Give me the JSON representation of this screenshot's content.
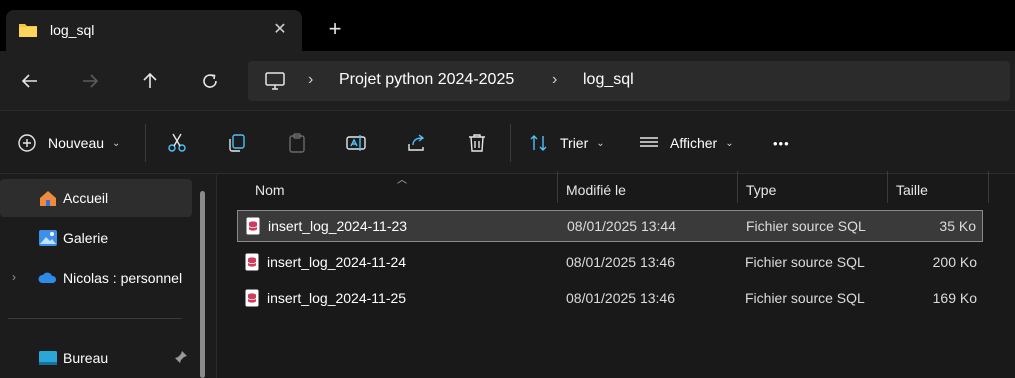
{
  "tab": {
    "title": "log_sql",
    "close_symbol": "✕",
    "new_tab_symbol": "+"
  },
  "nav": {
    "back_icon": "arrow-left-icon",
    "forward_icon": "arrow-right-icon",
    "up_icon": "arrow-up-icon",
    "refresh_icon": "refresh-icon",
    "breadcrumb": [
      "Projet python 2024-2025",
      "log_sql"
    ]
  },
  "toolbar": {
    "new_label": "Nouveau",
    "sort_label": "Trier",
    "view_label": "Afficher",
    "more_symbol": "•••"
  },
  "sidebar": {
    "items": [
      {
        "label": "Accueil",
        "icon": "home-icon"
      },
      {
        "label": "Galerie",
        "icon": "gallery-icon"
      },
      {
        "label": "Nicolas : personnel",
        "icon": "onedrive-cloud-icon"
      },
      {
        "label": "Bureau",
        "icon": "desktop-icon"
      }
    ]
  },
  "columns": {
    "name": "Nom",
    "modified": "Modifié le",
    "type": "Type",
    "size": "Taille"
  },
  "files": [
    {
      "name": "insert_log_2024-11-23",
      "modified": "08/01/2025 13:44",
      "type": "Fichier source SQL",
      "size": "35 Ko"
    },
    {
      "name": "insert_log_2024-11-24",
      "modified": "08/01/2025 13:46",
      "type": "Fichier source SQL",
      "size": "200 Ko"
    },
    {
      "name": "insert_log_2024-11-25",
      "modified": "08/01/2025 13:46",
      "type": "Fichier source SQL",
      "size": "169 Ko"
    }
  ],
  "colors": {
    "accent": "#4cc2ff",
    "folder": "#f4c542",
    "sql_icon": "#d13b5f"
  }
}
